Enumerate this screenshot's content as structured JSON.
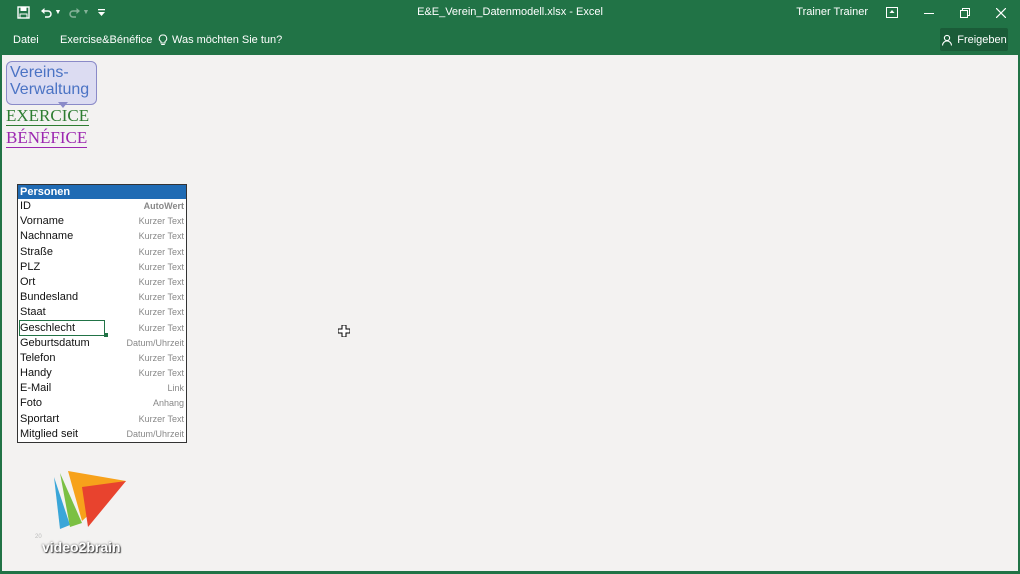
{
  "window": {
    "title": "E&E_Verein_Datenmodell.xlsx - Excel",
    "user": "Trainer Trainer"
  },
  "ribbon": {
    "menu_file": "Datei",
    "menu_custom": "Exercise&Bénéfice",
    "tell_me": "Was möchten Sie tun?",
    "share": "Freigeben"
  },
  "logo": {
    "line1": "Vereins-",
    "line2": "Verwaltung",
    "exercice": "EXERCICE",
    "benefice": "BÉNÉFICE"
  },
  "table": {
    "title": "Personen",
    "rows": [
      {
        "name": "ID",
        "type": "AutoWert"
      },
      {
        "name": "Vorname",
        "type": "Kurzer Text"
      },
      {
        "name": "Nachname",
        "type": "Kurzer Text"
      },
      {
        "name": "Straße",
        "type": "Kurzer Text"
      },
      {
        "name": "PLZ",
        "type": "Kurzer Text"
      },
      {
        "name": "Ort",
        "type": "Kurzer Text"
      },
      {
        "name": "Bundesland",
        "type": "Kurzer Text"
      },
      {
        "name": "Staat",
        "type": "Kurzer Text"
      },
      {
        "name": "Geschlecht",
        "type": "Kurzer Text"
      },
      {
        "name": "Geburtsdatum",
        "type": "Datum/Uhrzeit"
      },
      {
        "name": "Telefon",
        "type": "Kurzer Text"
      },
      {
        "name": "Handy",
        "type": "Kurzer Text"
      },
      {
        "name": "E-Mail",
        "type": "Link"
      },
      {
        "name": "Foto",
        "type": "Anhang"
      },
      {
        "name": "Sportart",
        "type": "Kurzer Text"
      },
      {
        "name": "Mitglied seit",
        "type": "Datum/Uhrzeit"
      }
    ]
  },
  "watermark": {
    "brand": "video2brain",
    "page": "20"
  },
  "icons": {
    "save": "save-icon",
    "undo": "undo-icon",
    "redo": "redo-icon",
    "customize": "customize-qat-icon",
    "ribbon_display": "ribbon-display-icon",
    "minimize": "minimize-icon",
    "restore": "restore-icon",
    "close": "close-icon",
    "lightbulb": "lightbulb-icon",
    "person": "person-icon"
  },
  "colors": {
    "excel_green": "#217346",
    "table_header": "#1f6bb4"
  }
}
